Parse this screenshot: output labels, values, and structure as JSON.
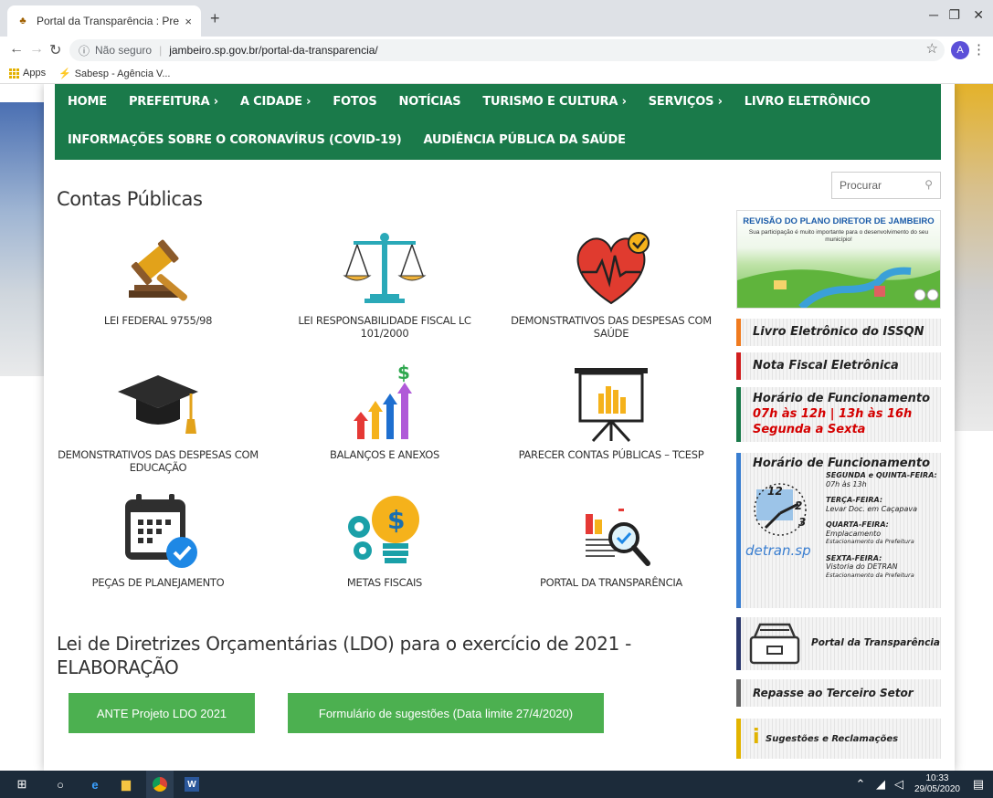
{
  "browser": {
    "tab_title": "Portal da Transparência : Prefeitu",
    "tab_close": "×",
    "new_tab": "+",
    "security": "Não seguro",
    "url": "jambeiro.sp.gov.br/portal-da-transparencia/",
    "avatar": "A",
    "bookmarks": [
      "Apps",
      "Sabesp - Agência V..."
    ]
  },
  "nav": {
    "row1": [
      "HOME",
      "PREFEITURA ›",
      "A CIDADE ›",
      "FOTOS",
      "NOTÍCIAS",
      "TURISMO E CULTURA ›",
      "SERVIÇOS ›",
      "LIVRO ELETRÔNICO"
    ],
    "row2": [
      "INFORMAÇÕES SOBRE O CORONAVÍRUS (COVID-19)",
      "AUDIÊNCIA PÚBLICA DA SAÚDE"
    ]
  },
  "main": {
    "title": "Contas Públicas",
    "items": [
      {
        "label": "LEI FEDERAL 9755/98",
        "icon": "gavel-icon"
      },
      {
        "label": "LEI RESPONSABILIDADE FISCAL LC 101/2000",
        "icon": "scales-icon"
      },
      {
        "label": "DEMONSTRATIVOS DAS DESPESAS COM SAÚDE",
        "icon": "heart-icon"
      },
      {
        "label": "DEMONSTRATIVOS DAS DESPESAS COM EDUCAÇÃO",
        "icon": "graduation-cap-icon"
      },
      {
        "label": "BALANÇOS E ANEXOS",
        "icon": "growth-arrows-icon"
      },
      {
        "label": "PARECER CONTAS PÚBLICAS – TCESP",
        "icon": "presentation-board-icon"
      },
      {
        "label": "PEÇAS DE PLANEJAMENTO",
        "icon": "calendar-check-icon"
      },
      {
        "label": "METAS FISCAIS",
        "icon": "lightbulb-money-icon"
      },
      {
        "label": "PORTAL DA TRANSPARÊNCIA",
        "icon": "report-magnifier-icon"
      }
    ],
    "ldo_title": "Lei de Diretrizes Orçamentárias (LDO) para o exercício de 2021 - ELABORAÇÃO",
    "buttons": [
      "ANTE Projeto LDO 2021",
      "Formulário de sugestões (Data limite 27/4/2020)"
    ]
  },
  "sidebar": {
    "search_placeholder": "Procurar",
    "banner_title": "REVISÃO DO PLANO DIRETOR DE JAMBEIRO",
    "banner_sub": "Sua participação é muito importante para o desenvolvimento do seu município!",
    "issqn": "Livro Eletrônico do ISSQN",
    "nfe": "Nota Fiscal Eletrônica",
    "horario_title": "Horário de Funcionamento",
    "horario_line1": "07h às 12h | 13h às 16h",
    "horario_line2": "Segunda a Sexta",
    "detran_title": "Horário de Funcionamento",
    "detran_logo": "detran.sp",
    "detran_schedule": [
      {
        "day": "SEGUNDA e QUINTA-FEIRA:",
        "info": "07h às 13h"
      },
      {
        "day": "TERÇA-FEIRA:",
        "info": "Levar Doc. em Caçapava"
      },
      {
        "day": "QUARTA-FEIRA:",
        "info": "Emplacamento",
        "extra": "Estacionamento da Prefeitura"
      },
      {
        "day": "SEXTA-FEIRA:",
        "info": "Vistoria do DETRAN",
        "extra": "Estacionamento da Prefeitura"
      }
    ],
    "portal": "Portal da Transparência",
    "repasse": "Repasse ao Terceiro Setor",
    "sugestoes": "Sugestões e Reclamações"
  },
  "taskbar": {
    "time": "10:33",
    "date": "29/05/2020"
  },
  "colors": {
    "nav_green": "#1a7a4a",
    "button_green": "#4cb050"
  }
}
